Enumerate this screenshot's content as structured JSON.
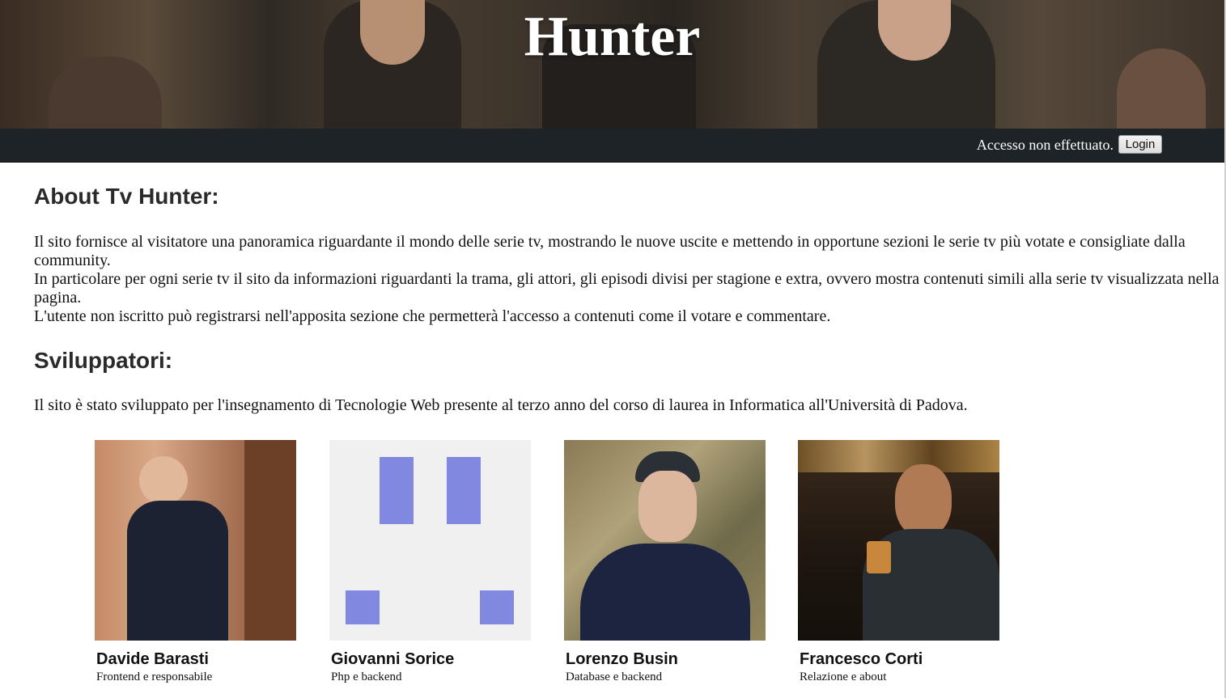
{
  "header": {
    "title": "Hunter"
  },
  "navbar": {
    "status_text": "Accesso non effettuato.",
    "login_label": "Login"
  },
  "about": {
    "title": "About Tv Hunter:",
    "paragraphs": [
      "Il sito fornisce al visitatore una panoramica riguardante il mondo delle serie tv, mostrando le nuove uscite e mettendo in opportune sezioni le serie tv più votate e consigliate dalla community.",
      "In particolare per ogni serie tv il sito da informazioni riguardanti la trama, gli attori, gli episodi divisi per stagione e extra, ovvero mostra contenuti simili alla serie tv visualizzata nella pagina.",
      "L'utente non iscritto può registrarsi nell'apposita sezione che permetterà l'accesso a contenuti come il votare e commentare."
    ]
  },
  "developers": {
    "title": "Sviluppatori:",
    "intro": "Il sito è stato sviluppato per l'insegnamento di Tecnologie Web presente al terzo anno del corso di laurea in Informatica all'Università di Padova.",
    "people": [
      {
        "name": "Davide Barasti",
        "role": "Frontend e responsabile"
      },
      {
        "name": "Giovanni Sorice",
        "role": "Php e backend"
      },
      {
        "name": "Lorenzo Busin",
        "role": "Database e backend"
      },
      {
        "name": "Francesco Corti",
        "role": "Relazione e about"
      }
    ]
  },
  "colors": {
    "navbar_bg": "#1e2328",
    "identicon_fg": "#8088e0",
    "identicon_bg": "#f0f0f0"
  }
}
